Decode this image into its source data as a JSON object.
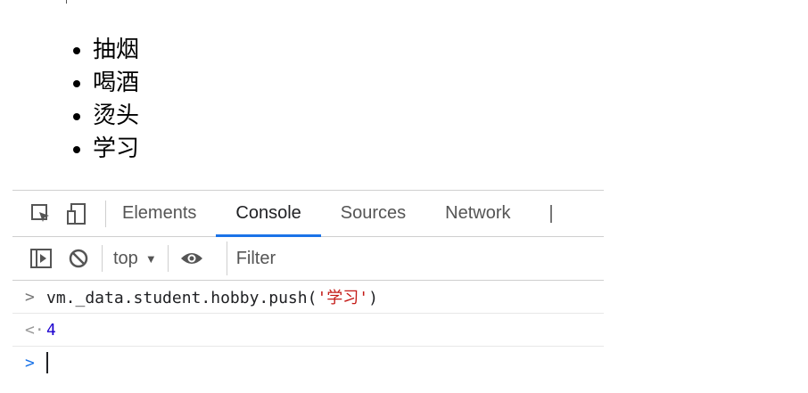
{
  "page": {
    "hobbies": [
      "抽烟",
      "喝酒",
      "烫头",
      "学习"
    ]
  },
  "devtools": {
    "tabs": [
      {
        "label": "Elements",
        "active": false
      },
      {
        "label": "Console",
        "active": true
      },
      {
        "label": "Sources",
        "active": false
      },
      {
        "label": "Network",
        "active": false
      }
    ],
    "icons": {
      "inspect": "select-element-icon",
      "device": "device-toggle-icon",
      "sidebar": "console-sidebar-icon",
      "clear": "clear-console-icon",
      "eye": "live-expression-icon"
    },
    "context_selector": {
      "value": "top",
      "arrow": "▼"
    },
    "filter": {
      "placeholder": "Filter"
    },
    "console": {
      "command_prefix": "vm._data.student.hobby.push(",
      "command_string": "'学习'",
      "command_suffix": ")",
      "result": "4"
    },
    "accent_color": "#1a73e8"
  }
}
